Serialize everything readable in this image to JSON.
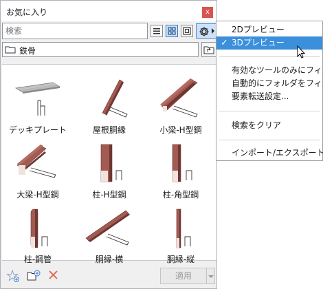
{
  "palette": {
    "title": "お気に入り",
    "close_label": "x",
    "search_placeholder": "検索",
    "folder": "鉄骨",
    "apply_label": "適用"
  },
  "view_buttons": [
    {
      "name": "list-view-icon",
      "active": false
    },
    {
      "name": "grid-view-icon",
      "active": true
    },
    {
      "name": "preview-view-icon",
      "active": false
    }
  ],
  "items": [
    {
      "label": "デッキプレート",
      "icon": "deck-plate-icon"
    },
    {
      "label": "屋根胴縁",
      "icon": "roof-purlin-icon"
    },
    {
      "label": "小梁-H型鋼",
      "icon": "small-beam-h-icon"
    },
    {
      "label": "大梁-H型鋼",
      "icon": "large-beam-h-icon"
    },
    {
      "label": "柱-H型鋼",
      "icon": "column-h-icon"
    },
    {
      "label": "柱-角型鋼",
      "icon": "column-square-icon"
    },
    {
      "label": "柱-鋼管",
      "icon": "column-pipe-icon"
    },
    {
      "label": "胴縁-横",
      "icon": "girt-horizontal-icon"
    },
    {
      "label": "胴縁-縦",
      "icon": "girt-vertical-icon"
    }
  ],
  "menu": {
    "items": [
      {
        "label": "2Dプレビュー",
        "checked": false,
        "selected": false
      },
      {
        "label": "3Dプレビュー",
        "checked": true,
        "selected": true
      },
      {
        "label": "有効なツールのみにフィルタ",
        "checked": false,
        "selected": false
      },
      {
        "label": "自動的にフォルダをフィルタ",
        "checked": false,
        "selected": false
      },
      {
        "label": "要素転送設定...",
        "checked": false,
        "selected": false
      },
      {
        "label": "検索をクリア",
        "checked": false,
        "selected": false
      },
      {
        "label": "インポート/エクスポート...",
        "checked": false,
        "selected": false
      }
    ],
    "check_mark": "✓"
  },
  "colors": {
    "steel": "#a25a52",
    "steel_dark": "#6e3732",
    "menu_highlight": "#3b8fdb",
    "close_red": "#d9534f"
  }
}
